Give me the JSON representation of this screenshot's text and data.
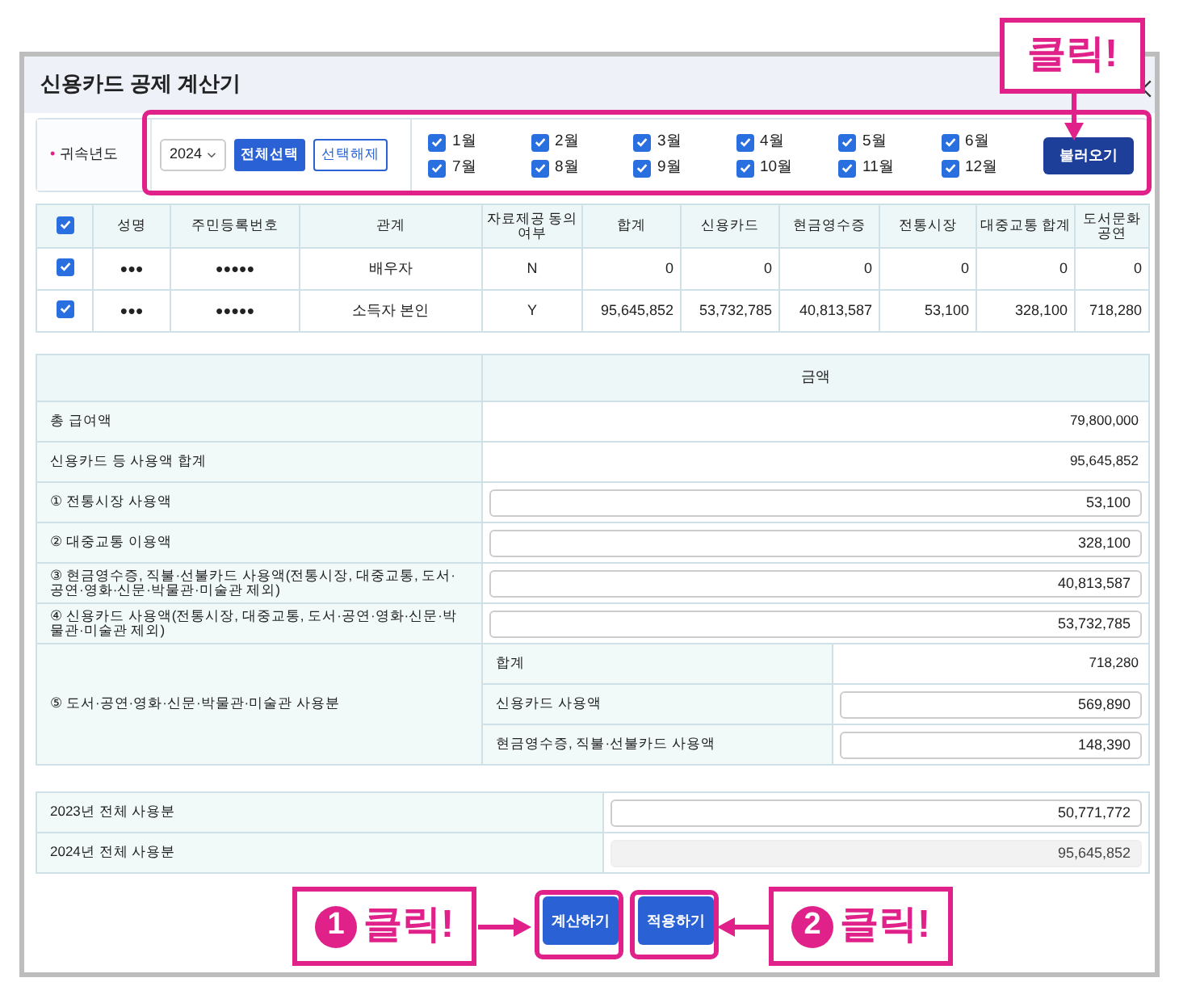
{
  "window": {
    "title": "신용카드 공제 계산기"
  },
  "filter": {
    "required_mark": "•",
    "label": "귀속년도",
    "year": "2024",
    "select_all": "전체선택",
    "deselect_all": "선택해제",
    "load_button": "불러오기",
    "months": [
      {
        "label": "1월",
        "checked": true
      },
      {
        "label": "2월",
        "checked": true
      },
      {
        "label": "3월",
        "checked": true
      },
      {
        "label": "4월",
        "checked": true
      },
      {
        "label": "5월",
        "checked": true
      },
      {
        "label": "6월",
        "checked": true
      },
      {
        "label": "7월",
        "checked": true
      },
      {
        "label": "8월",
        "checked": true
      },
      {
        "label": "9월",
        "checked": true
      },
      {
        "label": "10월",
        "checked": true
      },
      {
        "label": "11월",
        "checked": true
      },
      {
        "label": "12월",
        "checked": true
      }
    ]
  },
  "family_table": {
    "all_checked": true,
    "columns": [
      "성명",
      "주민등록번호",
      "관계",
      "자료제공 동의여부",
      "합계",
      "신용카드",
      "현금영수증",
      "전통시장",
      "대중교통 합계",
      "도서문화공연"
    ],
    "rows": [
      {
        "checked": true,
        "cells": [
          "●●●",
          "●●●●●",
          "배우자",
          "N",
          "0",
          "0",
          "0",
          "0",
          "0",
          "0"
        ]
      },
      {
        "checked": true,
        "cells": [
          "●●●",
          "●●●●●",
          "소득자 본인",
          "Y",
          "95,645,852",
          "53,732,785",
          "40,813,587",
          "53,100",
          "328,100",
          "718,280"
        ]
      }
    ]
  },
  "summary": {
    "header": "금액",
    "rows": [
      {
        "kind": "text",
        "label": "총 급여액",
        "value": "79,800,000"
      },
      {
        "kind": "text",
        "label": "신용카드 등 사용액 합계",
        "value": "95,645,852"
      },
      {
        "kind": "input",
        "label": "① 전통시장 사용액",
        "value": "53,100"
      },
      {
        "kind": "input",
        "label": "② 대중교통 이용액",
        "value": "328,100"
      },
      {
        "kind": "input",
        "label": "③ 현금영수증, 직불·선불카드 사용액(전통시장, 대중교통, 도서·공연·영화·신문·박물관·미술관 제외)",
        "value": "40,813,587"
      },
      {
        "kind": "input",
        "label": "④ 신용카드 사용액(전통시장, 대중교통, 도서·공연·영화·신문·박물관·미술관 제외)",
        "value": "53,732,785"
      },
      {
        "kind": "group",
        "label": "⑤ 도서·공연·영화·신문·박물관·미술관 사용분",
        "items": [
          {
            "kind": "text",
            "label": "합계",
            "value": "718,280"
          },
          {
            "kind": "input",
            "label": "신용카드 사용액",
            "value": "569,890"
          },
          {
            "kind": "input",
            "label": "현금영수증, 직불·선불카드 사용액",
            "value": "148,390"
          }
        ]
      }
    ]
  },
  "totals": [
    {
      "kind": "input",
      "label": "2023년 전체 사용분",
      "value": "50,771,772"
    },
    {
      "kind": "readonly",
      "label": "2024년 전체 사용분",
      "value": "95,645,852"
    }
  ],
  "buttons": [
    "계산하기",
    "적용하기"
  ],
  "annotations": {
    "top": "클릭!",
    "steps": [
      {
        "number": "1",
        "text": "클릭!"
      },
      {
        "number": "2",
        "text": "클릭!"
      }
    ]
  }
}
